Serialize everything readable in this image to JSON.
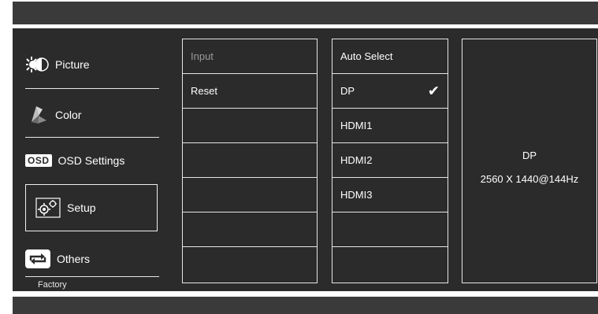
{
  "menu": {
    "items": [
      {
        "label": "Picture",
        "icon": "picture-icon"
      },
      {
        "label": "Color",
        "icon": "color-icon"
      },
      {
        "label": "OSD Settings",
        "icon": "osd-icon"
      },
      {
        "label": "Setup",
        "icon": "setup-icon"
      },
      {
        "label": "Others",
        "icon": "others-icon"
      }
    ],
    "osd_icon_text": "OSD",
    "footer": "Factory",
    "selected": "Setup"
  },
  "submenu": {
    "items": [
      "Input",
      "Reset",
      "",
      "",
      "",
      "",
      ""
    ]
  },
  "input_options": {
    "items": [
      "Auto Select",
      "DP",
      "HDMI1",
      "HDMI2",
      "HDMI3",
      "",
      ""
    ],
    "checked": "DP",
    "check_glyph": "✔"
  },
  "status": {
    "source": "DP",
    "resolution": "2560 X 1440@144Hz"
  },
  "colors": {
    "panel_bg": "#2b2b2b",
    "bar_bg": "#3a3a3a",
    "border": "#e6e6e6",
    "dim_text": "#9a9a9a"
  }
}
